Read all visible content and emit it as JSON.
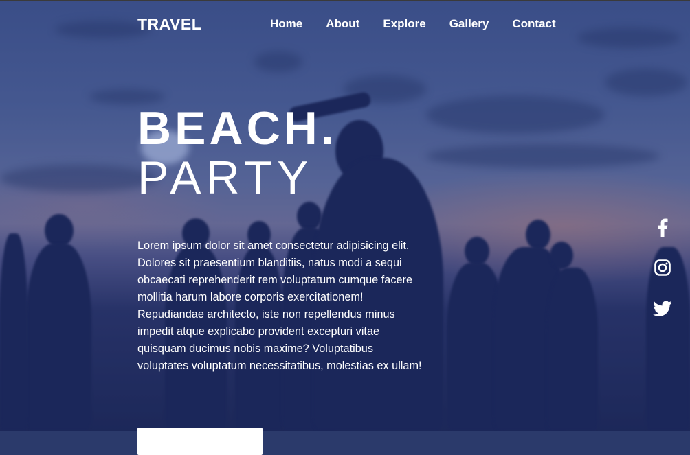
{
  "nav": {
    "logo": "TRAVEL",
    "links": [
      {
        "label": "Home"
      },
      {
        "label": "About"
      },
      {
        "label": "Explore"
      },
      {
        "label": "Gallery"
      },
      {
        "label": "Contact"
      }
    ]
  },
  "hero": {
    "title_line1": "BEACH.",
    "title_line2": "PARTY",
    "body": "Lorem ipsum dolor sit amet consectetur adipisicing elit. Dolores sit praesentium blanditiis, natus modi a sequi obcaecati reprehenderit rem voluptatum cumque facere mollitia harum labore corporis exercitationem! Repudiandae architecto, iste non repellendus minus impedit atque explicabo provident excepturi vitae quisquam ducimus nobis maxime? Voluptatibus voluptates voluptatum necessitatibus, molestias ex ullam!"
  },
  "social": {
    "icons": [
      "facebook-icon",
      "instagram-icon",
      "twitter-icon"
    ]
  },
  "colors": {
    "text": "#ffffff",
    "overlay": "#1e2d6e"
  }
}
